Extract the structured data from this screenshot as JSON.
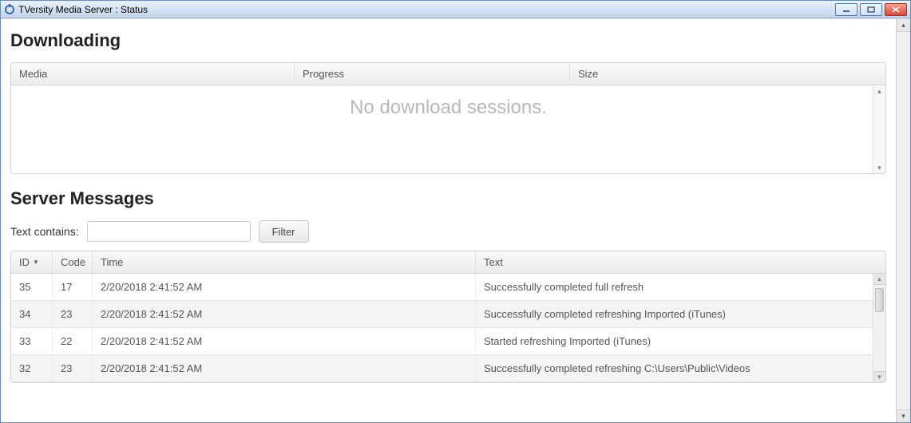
{
  "window": {
    "title": "TVersity Media Server : Status"
  },
  "sections": {
    "downloading_title": "Downloading",
    "server_messages_title": "Server Messages"
  },
  "download_table": {
    "headers": {
      "media": "Media",
      "progress": "Progress",
      "size": "Size"
    },
    "empty_text": "No download sessions."
  },
  "filter": {
    "label": "Text contains:",
    "value": "",
    "button": "Filter"
  },
  "messages_table": {
    "headers": {
      "id": "ID",
      "code": "Code",
      "time": "Time",
      "text": "Text"
    },
    "rows": [
      {
        "id": "35",
        "code": "17",
        "time": "2/20/2018 2:41:52 AM",
        "text": "Successfully completed full refresh"
      },
      {
        "id": "34",
        "code": "23",
        "time": "2/20/2018 2:41:52 AM",
        "text": "Successfully completed refreshing Imported (iTunes)"
      },
      {
        "id": "33",
        "code": "22",
        "time": "2/20/2018 2:41:52 AM",
        "text": "Started refreshing Imported (iTunes)"
      },
      {
        "id": "32",
        "code": "23",
        "time": "2/20/2018 2:41:52 AM",
        "text": "Successfully completed refreshing C:\\Users\\Public\\Videos"
      }
    ]
  }
}
